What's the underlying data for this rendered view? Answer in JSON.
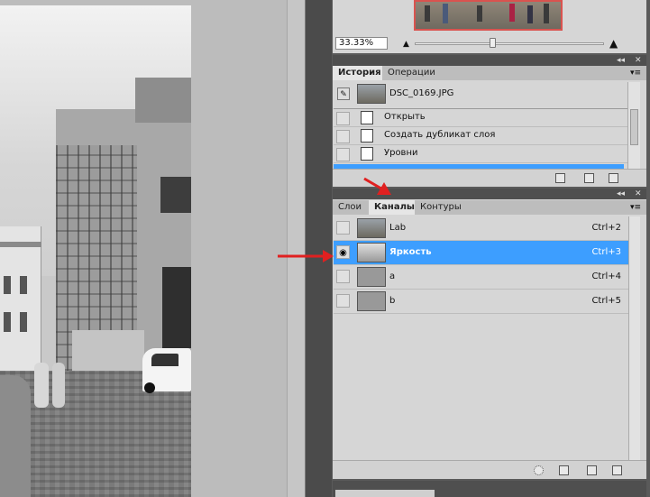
{
  "navigator": {
    "zoom": "33.33%"
  },
  "history_panel": {
    "tabs": [
      {
        "label": "История"
      },
      {
        "label": "Операции"
      }
    ],
    "snapshot": "DSC_0169.JPG",
    "items": [
      "Открыть",
      "Создать дубликат слоя",
      "Уровни"
    ]
  },
  "layers_panel": {
    "tabs": [
      {
        "label": "Слои"
      },
      {
        "label": "Каналы"
      },
      {
        "label": "Контуры"
      }
    ],
    "channels": [
      {
        "name": "Lab",
        "shortcut": "Ctrl+2"
      },
      {
        "name": "Яркость",
        "shortcut": "Ctrl+3"
      },
      {
        "name": "a",
        "shortcut": "Ctrl+4"
      },
      {
        "name": "b",
        "shortcut": "Ctrl+5"
      }
    ]
  },
  "colors": {
    "selection": "#3d9eff",
    "arrow": "#e02020"
  }
}
